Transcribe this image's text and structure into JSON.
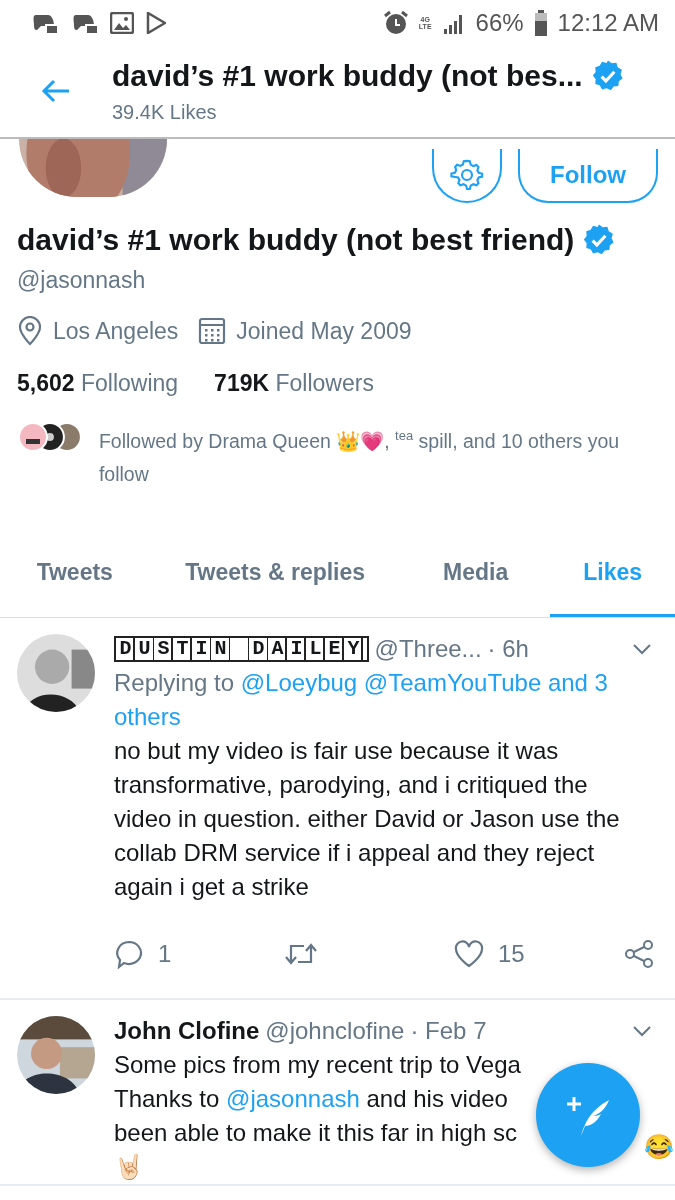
{
  "status_bar": {
    "time": "12:12 AM",
    "battery": "66%",
    "network": [
      "4G",
      "LTE"
    ]
  },
  "header": {
    "title": "david’s #1 work buddy (not bes...",
    "verified": true,
    "subtitle": "39.4K Likes"
  },
  "profile": {
    "follow_button": "Follow",
    "name": "david’s #1 work buddy (not best friend)",
    "verified": true,
    "handle": "@jasonnash",
    "location": "Los Angeles",
    "joined": "Joined May 2009",
    "stats": [
      {
        "count": "5,602",
        "label": "Following"
      },
      {
        "count": "719K",
        "label": "Followers"
      }
    ],
    "followed_by": "Followed by Drama Queen 👑💗, $^{tea}$ spill, and 10 others you follow"
  },
  "tabs": [
    {
      "label": "Tweets",
      "selected": false
    },
    {
      "label": "Tweets & replies",
      "selected": false
    },
    {
      "label": "Media",
      "selected": false
    },
    {
      "label": "Likes",
      "selected": true
    }
  ],
  "tweets": [
    {
      "name": "DUSTIN DAILEY",
      "boxed_name": true,
      "handle": "@Three...",
      "time": "· 6h",
      "replying_label": "Replying to",
      "replying_to": "@Loeybug @TeamYouTube and 3 others",
      "lines": [
        "no but my video is fair use because it was transformative, parodying, and i critiqued the video in question. either David or Jason use the collab DRM service if i appeal and they reject again i get a strike"
      ],
      "replies": "1",
      "likes": "15"
    },
    {
      "name": "John Clofine",
      "boxed_name": false,
      "handle": "@johnclofine",
      "time": "· Feb 7",
      "lines": [
        "Some pics from my recent trip to Vega",
        "Thanks to **@jasonnash** and his video",
        "been able to make it this far in high sc"
      ],
      "trailing_emoji": "😂",
      "last_line": "🤘🏻"
    }
  ]
}
